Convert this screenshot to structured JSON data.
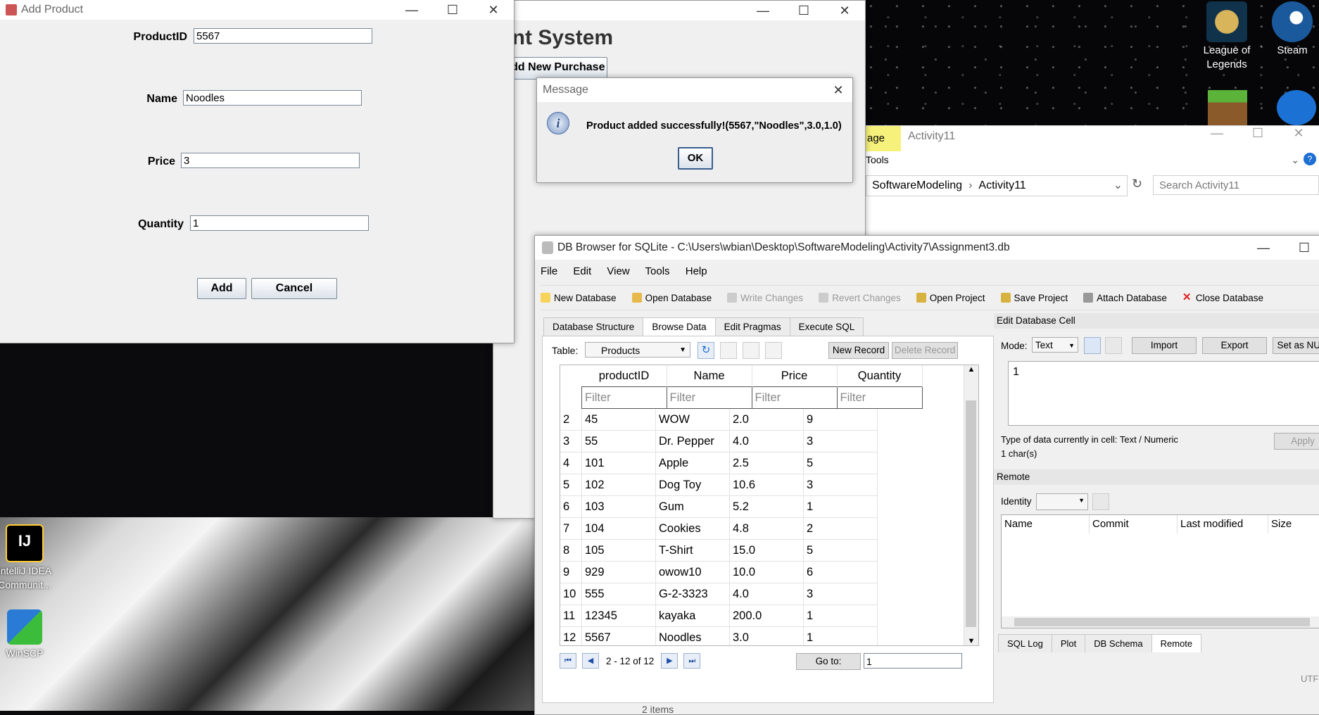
{
  "desktop": {
    "icons": [
      {
        "label": "League of Legends"
      },
      {
        "label": "Steam"
      },
      {
        "label": "IntelliJ IDEA Communit..."
      },
      {
        "label": "WinSCP"
      }
    ]
  },
  "add_product": {
    "title": "Add Product",
    "fields": [
      {
        "label": "ProductID",
        "value": "5567"
      },
      {
        "label": "Name",
        "value": "Noodles"
      },
      {
        "label": "Price",
        "value": "3"
      },
      {
        "label": "Quantity",
        "value": "1"
      }
    ],
    "add_label": "Add",
    "cancel_label": "Cancel"
  },
  "mgmt": {
    "title_fragment": "ent System",
    "purchase_label": "Add New Purchase"
  },
  "message": {
    "title": "Message",
    "text": "Product added successfully!(5567,\"Noodles\",3.0,1.0)",
    "ok_label": "OK"
  },
  "explorer": {
    "tab_partial": "age",
    "tab_title": "Activity11",
    "tools_label": "Tools",
    "breadcrumb": [
      "SoftwareModeling",
      "Activity11"
    ],
    "search_placeholder": "Search Activity11"
  },
  "dbb": {
    "title": "DB Browser for SQLite - C:\\Users\\wbian\\Desktop\\SoftwareModeling\\Activity7\\Assignment3.db",
    "menu": [
      "File",
      "Edit",
      "View",
      "Tools",
      "Help"
    ],
    "toolbar": [
      "New Database",
      "Open Database",
      "Write Changes",
      "Revert Changes",
      "Open Project",
      "Save Project",
      "Attach Database",
      "Close Database"
    ],
    "tabs": [
      "Database Structure",
      "Browse Data",
      "Edit Pragmas",
      "Execute SQL"
    ],
    "table_label": "Table:",
    "table_value": "Products",
    "new_record": "New Record",
    "delete_record": "Delete Record",
    "columns": [
      "productID",
      "Name",
      "Price",
      "Quantity"
    ],
    "filter_placeholder": "Filter",
    "rows": [
      [
        "2",
        "45",
        "WOW",
        "2.0",
        "9"
      ],
      [
        "3",
        "55",
        "Dr. Pepper",
        "4.0",
        "3"
      ],
      [
        "4",
        "101",
        "Apple",
        "2.5",
        "5"
      ],
      [
        "5",
        "102",
        "Dog Toy",
        "10.6",
        "3"
      ],
      [
        "6",
        "103",
        "Gum",
        "5.2",
        "1"
      ],
      [
        "7",
        "104",
        "Cookies",
        "4.8",
        "2"
      ],
      [
        "8",
        "105",
        "T-Shirt",
        "15.0",
        "5"
      ],
      [
        "9",
        "929",
        "owow10",
        "10.0",
        "6"
      ],
      [
        "10",
        "555",
        "G-2-3323",
        "4.0",
        "3"
      ],
      [
        "11",
        "12345",
        "kayaka",
        "200.0",
        "1"
      ],
      [
        "12",
        "5567",
        "Noodles",
        "3.0",
        "1"
      ]
    ],
    "page_info": "2 - 12 of 12",
    "goto_label": "Go to:",
    "goto_value": "1",
    "edit_cell": {
      "header": "Edit Database Cell",
      "mode_label": "Mode:",
      "mode_value": "Text",
      "import": "Import",
      "export": "Export",
      "set_null": "Set as NUL",
      "value": "1",
      "type_info": "Type of data currently in cell: Text / Numeric",
      "size_info": "1 char(s)",
      "apply": "Apply"
    },
    "remote": {
      "header": "Remote",
      "identity_label": "Identity",
      "columns": [
        "Name",
        "Commit",
        "Last modified",
        "Size"
      ]
    },
    "bottom_tabs": [
      "SQL Log",
      "Plot",
      "DB Schema",
      "Remote"
    ],
    "encoding": "UTF-"
  },
  "status_items": "2 items"
}
